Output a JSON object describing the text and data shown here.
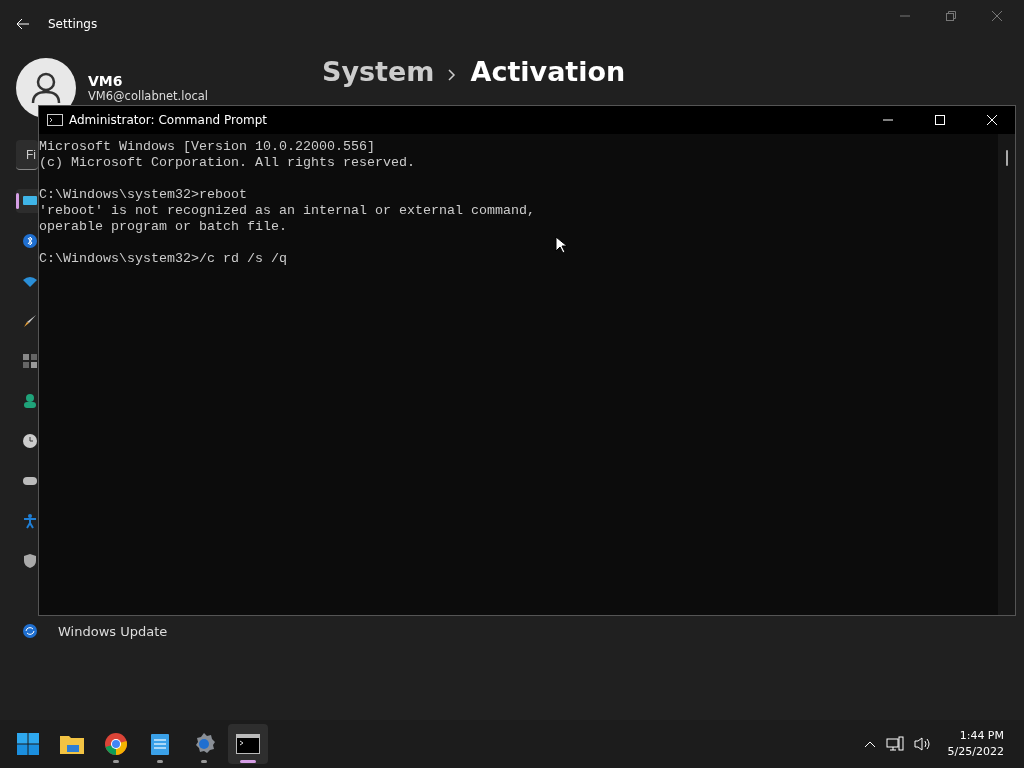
{
  "settings": {
    "title": "Settings",
    "user": {
      "name": "VM6",
      "email": "VM6@collabnet.local"
    },
    "breadcrumb": [
      "System",
      "Activation"
    ],
    "search": {
      "placeholder": "Fi"
    },
    "sidebar": [
      {
        "kind": "system",
        "selected": true
      },
      {
        "kind": "bluetooth",
        "selected": false
      },
      {
        "kind": "network",
        "selected": false
      },
      {
        "kind": "brush",
        "selected": false
      },
      {
        "kind": "apps",
        "selected": false
      },
      {
        "kind": "accounts",
        "selected": false
      },
      {
        "kind": "time",
        "selected": false
      },
      {
        "kind": "gaming",
        "selected": false
      },
      {
        "kind": "accessibility",
        "selected": false
      },
      {
        "kind": "privacy",
        "selected": false
      },
      {
        "kind": "update",
        "selected": false,
        "label": "Windows Update"
      }
    ]
  },
  "cmd": {
    "title": "Administrator: Command Prompt",
    "blocks": [
      [
        "Microsoft Windows [Version 10.0.22000.556]",
        "(c) Microsoft Corporation. All rights reserved."
      ],
      [
        "C:\\Windows\\system32>reboot",
        "'reboot' is not recognized as an internal or external command,",
        "operable program or batch file."
      ],
      [
        "C:\\Windows\\system32>/c rd /s /q"
      ]
    ]
  },
  "taskbar": {
    "apps": [
      {
        "kind": "start",
        "running": false,
        "selected": false
      },
      {
        "kind": "folder",
        "running": false,
        "selected": false
      },
      {
        "kind": "browser",
        "running": true,
        "selected": false
      },
      {
        "kind": "notepad",
        "running": true,
        "selected": false
      },
      {
        "kind": "gear",
        "running": true,
        "selected": false
      },
      {
        "kind": "terminal",
        "running": true,
        "selected": true
      }
    ],
    "time": "1:44 PM",
    "date": "5/25/2022"
  }
}
